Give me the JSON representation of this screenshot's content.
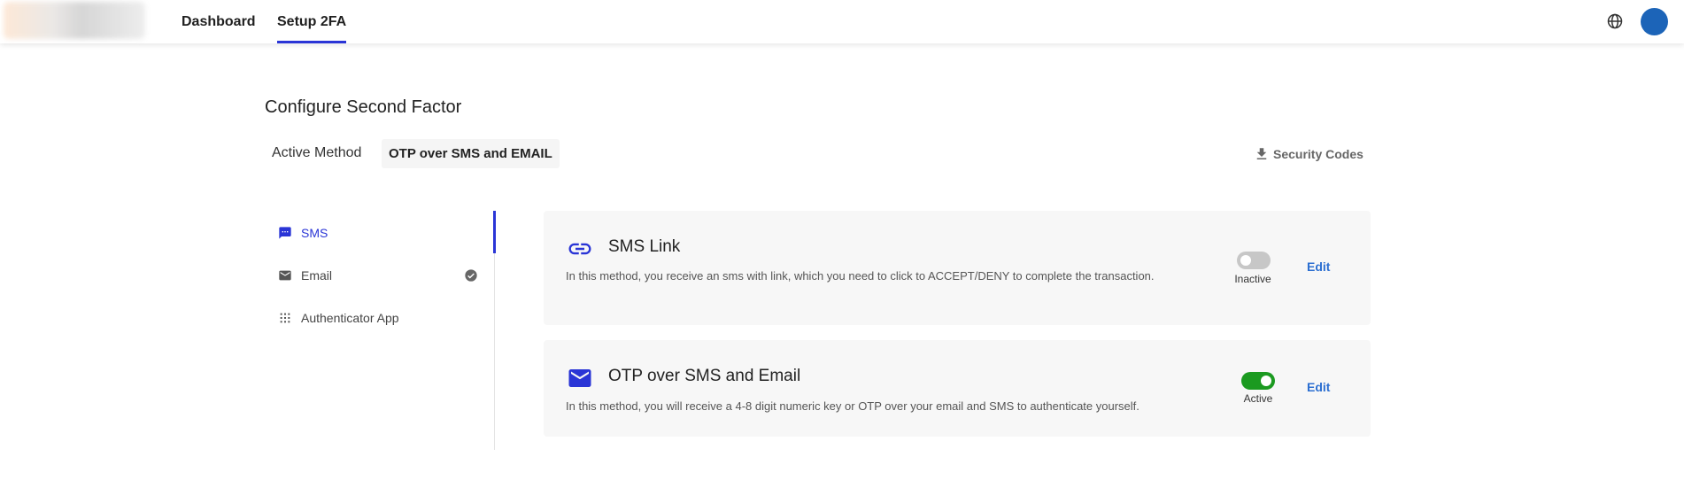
{
  "header": {
    "tabs": [
      {
        "label": "Dashboard"
      },
      {
        "label": "Setup 2FA"
      }
    ]
  },
  "page": {
    "title": "Configure Second Factor",
    "active_method_label": "Active Method",
    "active_method_value": "OTP over SMS and EMAIL",
    "security_codes_label": "Security Codes"
  },
  "sidebar": {
    "items": [
      {
        "label": "SMS",
        "icon": "chat-icon",
        "selected": true
      },
      {
        "label": "Email",
        "icon": "mail-icon",
        "verified": true
      },
      {
        "label": "Authenticator App",
        "icon": "grid-icon"
      }
    ]
  },
  "methods": [
    {
      "title": "SMS Link",
      "icon": "link-icon",
      "description": "In this method, you receive an sms with link, which you need to click to ACCEPT/DENY to complete the transaction.",
      "status": "Inactive",
      "edit_label": "Edit"
    },
    {
      "title": "OTP over SMS and Email",
      "icon": "mail-icon",
      "description": "In this method, you will receive a 4-8 digit numeric key or OTP over your email and SMS to authenticate yourself.",
      "status": "Active",
      "edit_label": "Edit"
    }
  ],
  "colors": {
    "accent": "#2a35d6",
    "active_toggle": "#1b9a20",
    "inactive_toggle": "#c7c7c7",
    "link": "#2c6fd1",
    "avatar": "#1c64b8"
  }
}
